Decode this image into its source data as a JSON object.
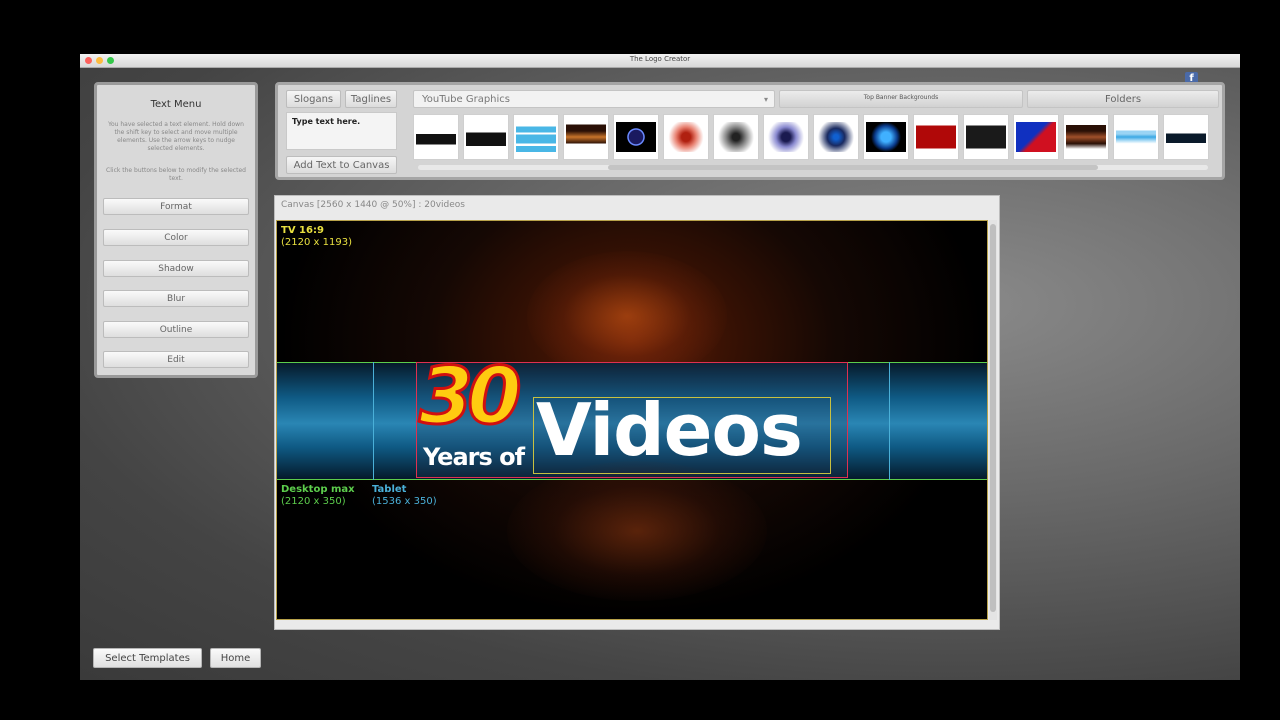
{
  "window": {
    "title": "The Logo Creator"
  },
  "text_menu": {
    "title": "Text Menu",
    "description": "You have selected a text element. Hold down the shift key to select and move multiple elements. Use the arrow keys to nudge selected elements.",
    "instructions": "Click the buttons below to modify the selected text.",
    "buttons": [
      "Format",
      "Color",
      "Shadow",
      "Blur",
      "Outline",
      "Edit"
    ]
  },
  "top_panel": {
    "slogans": "Slogans",
    "taglines": "Taglines",
    "text_input_value": "Type text here.",
    "add_text": "Add Text to Canvas",
    "category_select": "YouTube Graphics",
    "tab_selected": "Top Banner Backgrounds",
    "tab_folders": "Folders"
  },
  "canvas": {
    "title": "Canvas [2560 x 1440 @ 50%] : 20videos",
    "zones": [
      {
        "name": "TV 16:9",
        "size": "(2120 x 1193)",
        "color": "#e8e040"
      },
      {
        "name": "Desktop max",
        "size": "(2120 x 350)",
        "color": "#5ccd4c"
      },
      {
        "name": "Tablet",
        "size": "(1536 x 350)",
        "color": "#4ab0d8"
      }
    ],
    "logo": {
      "number": "30",
      "years": "Years of",
      "word": "Videos"
    }
  },
  "footer": {
    "select_templates": "Select Templates",
    "home": "Home"
  },
  "icons": {
    "facebook": "facebook-icon"
  }
}
